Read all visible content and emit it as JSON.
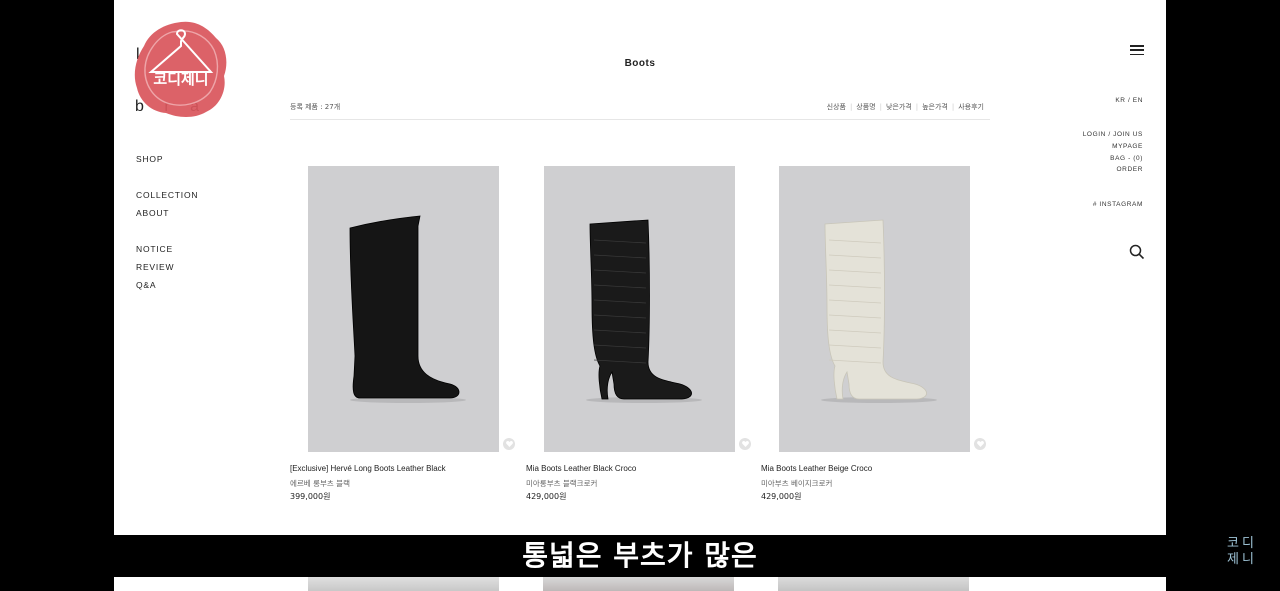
{
  "brand": {
    "logo_text_top": "l",
    "logo_text_bottom": "b r a",
    "stamp_label": "코디제니"
  },
  "nav": {
    "shop": "SHOP",
    "collection": "COLLECTION",
    "about": "ABOUT",
    "notice": "NOTICE",
    "review": "REVIEW",
    "qa": "Q&A"
  },
  "header": {
    "title": "Boots"
  },
  "listing": {
    "count_label": "등록 제품 : 27개",
    "sort_options": [
      "신상품",
      "상품명",
      "낮은가격",
      "높은가격",
      "사용후기"
    ]
  },
  "utility": {
    "lang": "KR / EN",
    "login": "LOGIN / JOIN US",
    "mypage": "MYPAGE",
    "bag": "BAG - (0)",
    "order": "ORDER",
    "instagram": "# INSTAGRAM"
  },
  "products": [
    {
      "name": "[Exclusive] Hervé Long Boots Leather Black",
      "name_kr": "에르베 롱부츠 블랙",
      "price": "399,000원",
      "color": "#151515",
      "style": "flat"
    },
    {
      "name": "Mia Boots Leather Black Croco",
      "name_kr": "미아롱부츠 블랙크로커",
      "price": "429,000원",
      "color": "#1a1a1a",
      "style": "heel"
    },
    {
      "name": "Mia Boots Leather Beige Croco",
      "name_kr": "미아부츠 베이지크로커",
      "price": "429,000원",
      "color": "#e4e2d8",
      "style": "heel"
    }
  ],
  "subtitle": "통넓은 부츠가 많은",
  "watermark": {
    "line1": "코디",
    "line2": "제니"
  },
  "icons": {
    "menu": "hamburger-icon",
    "search": "search-icon",
    "wishlist": "heart-icon",
    "stamp": "hanger-icon"
  },
  "colors": {
    "page_bg": "#ffffff",
    "frame_bg": "#000000",
    "stamp": "#d9565c",
    "product_bg": "#cfcfd1"
  }
}
